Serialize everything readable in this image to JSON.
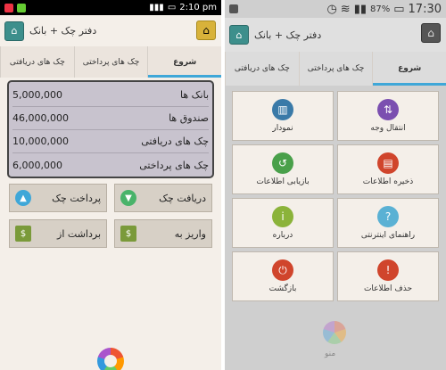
{
  "screen1": {
    "status": {
      "time": "2:10 pm"
    },
    "app_title": "دفتر چک + بانک",
    "tabs": [
      {
        "label": "چک های دریافتی"
      },
      {
        "label": "چک های پرداختی"
      },
      {
        "label": "شروع"
      }
    ],
    "balances": [
      {
        "label": "بانک ها",
        "value": "5,000,000"
      },
      {
        "label": "صندوق ها",
        "value": "46,000,000"
      },
      {
        "label": "چک های دریافتی",
        "value": "10,000,000"
      },
      {
        "label": "چک های پرداختی",
        "value": "6,000,000"
      }
    ],
    "actions": [
      {
        "label": "پرداخت چک",
        "icon": "arrow-up-icon",
        "color": "#3fa7d8"
      },
      {
        "label": "دریافت چک",
        "icon": "arrow-down-icon",
        "color": "#49b36a"
      },
      {
        "label": "برداشت از",
        "icon": "cash-out-icon",
        "color": "#7a9a3a"
      },
      {
        "label": "واریز به",
        "icon": "cash-in-icon",
        "color": "#7a9a3a"
      }
    ]
  },
  "screen2": {
    "status": {
      "battery": "87%",
      "time": "17:30"
    },
    "app_title": "دفتر چک + بانک",
    "tabs": [
      {
        "label": "چک های دریافتی"
      },
      {
        "label": "چک های پرداختی"
      },
      {
        "label": "شروع"
      }
    ],
    "tiles": [
      {
        "label": "نمودار",
        "icon": "chart-icon",
        "color": "#3a7aa8"
      },
      {
        "label": "انتقال وجه",
        "icon": "transfer-icon",
        "color": "#7b4fb0"
      },
      {
        "label": "بازیابی اطلاعات",
        "icon": "restore-icon",
        "color": "#49a04a"
      },
      {
        "label": "ذخیره اطلاعات",
        "icon": "save-icon",
        "color": "#d0452c"
      },
      {
        "label": "درباره",
        "icon": "info-icon",
        "color": "#8bb33a"
      },
      {
        "label": "راهنمای اینترنتی",
        "icon": "help-icon",
        "color": "#5ab1d4"
      },
      {
        "label": "بازگشت",
        "icon": "power-icon",
        "color": "#d0452c"
      },
      {
        "label": "حذف اطلاعات",
        "icon": "warning-icon",
        "color": "#d0452c"
      }
    ],
    "menu_label": "منو"
  }
}
